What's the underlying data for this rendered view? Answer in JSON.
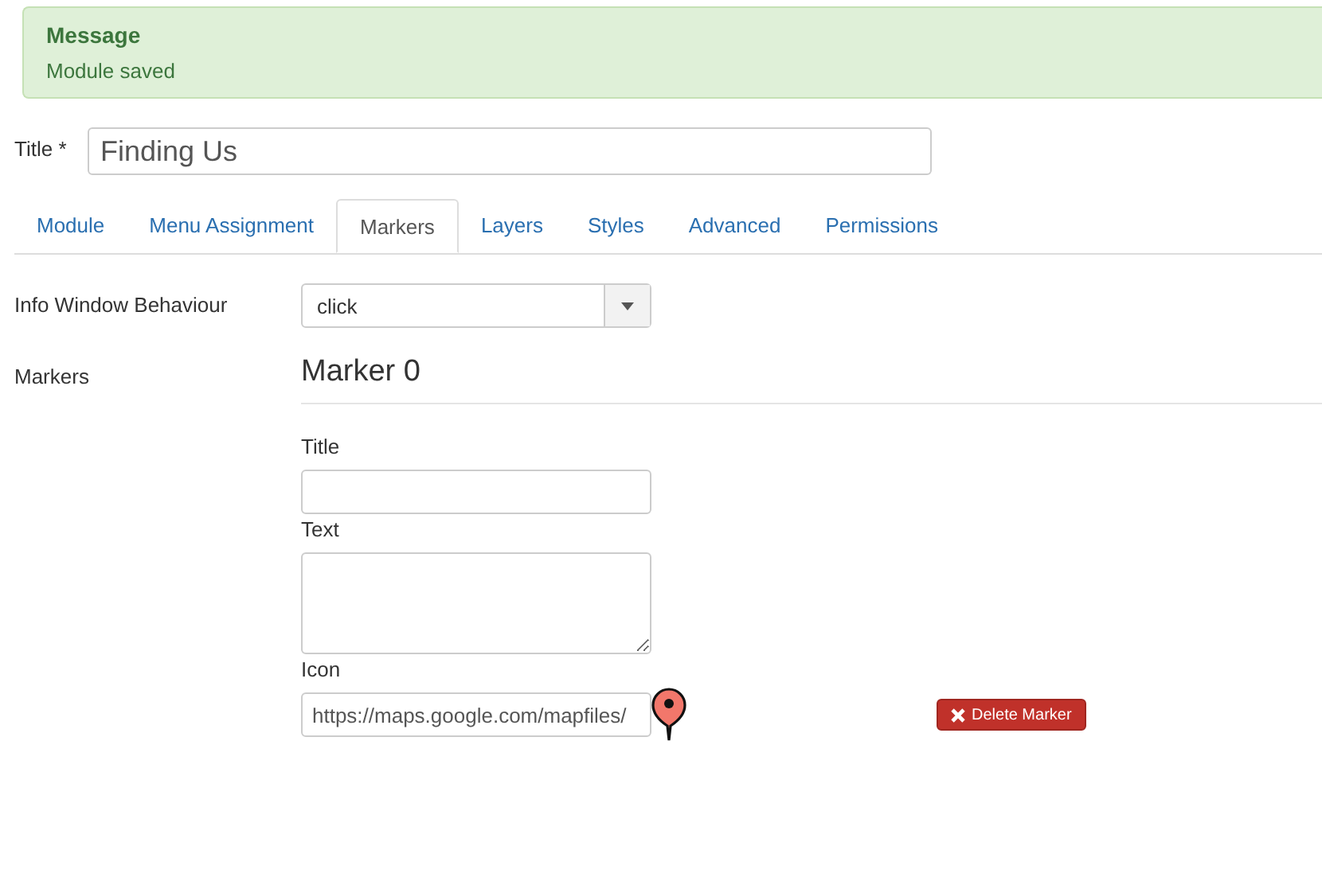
{
  "message": {
    "heading": "Message",
    "text": "Module saved"
  },
  "title_field": {
    "label": "Title *",
    "value": "Finding Us"
  },
  "tabs": [
    {
      "label": "Module",
      "selected": false
    },
    {
      "label": "Menu Assignment",
      "selected": false
    },
    {
      "label": "Markers",
      "selected": true
    },
    {
      "label": "Layers",
      "selected": false
    },
    {
      "label": "Styles",
      "selected": false
    },
    {
      "label": "Advanced",
      "selected": false
    },
    {
      "label": "Permissions",
      "selected": false
    }
  ],
  "info_window": {
    "label": "Info Window Behaviour",
    "value": "click"
  },
  "markers": {
    "label": "Markers",
    "items": [
      {
        "heading": "Marker 0",
        "title_label": "Title",
        "text_label": "Text",
        "icon_label": "Icon",
        "icon_value": "https://maps.google.com/mapfiles/",
        "delete_button": "Delete Marker"
      }
    ]
  }
}
